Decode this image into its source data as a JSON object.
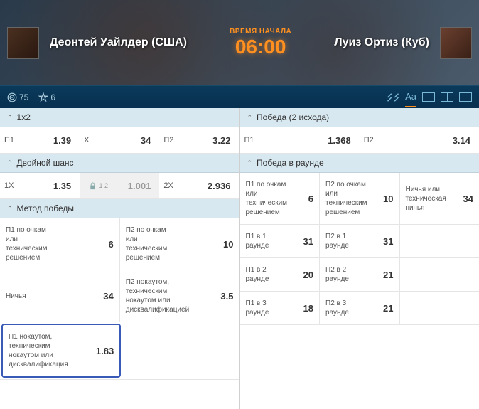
{
  "hero": {
    "fighter1": "Деонтей Уайлдер (США)",
    "fighter2": "Луиз Ортиз (Куб)",
    "time_label": "ВРЕМЯ НАЧАЛА",
    "time_value": "06:00"
  },
  "toolbar": {
    "target_count": "75",
    "star_count": "6",
    "aa": "Aa"
  },
  "left": {
    "s1": {
      "title": "1x2",
      "r": [
        {
          "l": "П1",
          "o": "1.39"
        },
        {
          "l": "X",
          "o": "34"
        },
        {
          "l": "П2",
          "o": "3.22"
        }
      ]
    },
    "s2": {
      "title": "Двойной шанс",
      "r": [
        {
          "l": "1X",
          "o": "1.35"
        },
        {
          "l": "",
          "o": "1.001",
          "lock": true,
          "sup": "1 2"
        },
        {
          "l": "2X",
          "o": "2.936"
        }
      ]
    },
    "s3": {
      "title": "Метод победы",
      "rows": [
        {
          "a": {
            "l": "П1 по очкам или техническим решением",
            "o": "6"
          },
          "b": {
            "l": "П2 по очкам или техническим решением",
            "o": "10"
          }
        },
        {
          "a": {
            "l": "Ничья",
            "o": "34"
          },
          "b": {
            "l": "П2 нокаутом, техническим нокаутом или дисквалификацией",
            "o": "3.5"
          }
        },
        {
          "a": {
            "l": "П1 нокаутом, техническим нокаутом или дисквалификация",
            "o": "1.83",
            "sel": true
          },
          "b": {
            "l": "",
            "o": ""
          }
        }
      ]
    }
  },
  "right": {
    "s1": {
      "title": "Победа (2 исхода)",
      "r": [
        {
          "l": "П1",
          "o": "1.368"
        },
        {
          "l": "П2",
          "o": "3.14"
        }
      ]
    },
    "s2": {
      "title": "Победа в раунде",
      "rows": [
        {
          "a": {
            "l": "П1 по очкам или техническим решением",
            "o": "6"
          },
          "b": {
            "l": "П2 по очкам или техническим решением",
            "o": "10"
          },
          "c": {
            "l": "Ничья или техническая ничья",
            "o": "34"
          }
        },
        {
          "a": {
            "l": "П1 в 1 раунде",
            "o": "31"
          },
          "b": {
            "l": "П2 в 1 раунде",
            "o": "31"
          },
          "c": {
            "l": "",
            "o": ""
          }
        },
        {
          "a": {
            "l": "П1 в 2 раунде",
            "o": "20"
          },
          "b": {
            "l": "П2 в 2 раунде",
            "o": "21"
          },
          "c": {
            "l": "",
            "o": ""
          }
        },
        {
          "a": {
            "l": "П1 в 3 раунде",
            "o": "18"
          },
          "b": {
            "l": "П2 в 3 раунде",
            "o": "21"
          },
          "c": {
            "l": "",
            "o": ""
          }
        }
      ]
    }
  }
}
